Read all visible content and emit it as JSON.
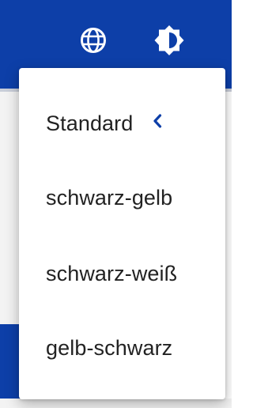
{
  "header": {
    "background_color": "#0d3fa8",
    "icons": {
      "language": "globe-icon",
      "theme": "contrast-icon"
    }
  },
  "menu": {
    "items": [
      {
        "label": "Standard",
        "selected": true
      },
      {
        "label": "schwarz-gelb",
        "selected": false
      },
      {
        "label": "schwarz-weiß",
        "selected": false
      },
      {
        "label": "gelb-schwarz",
        "selected": false
      }
    ],
    "selected_marker": "chevron-left-icon",
    "accent_color": "#0d3fa8"
  }
}
